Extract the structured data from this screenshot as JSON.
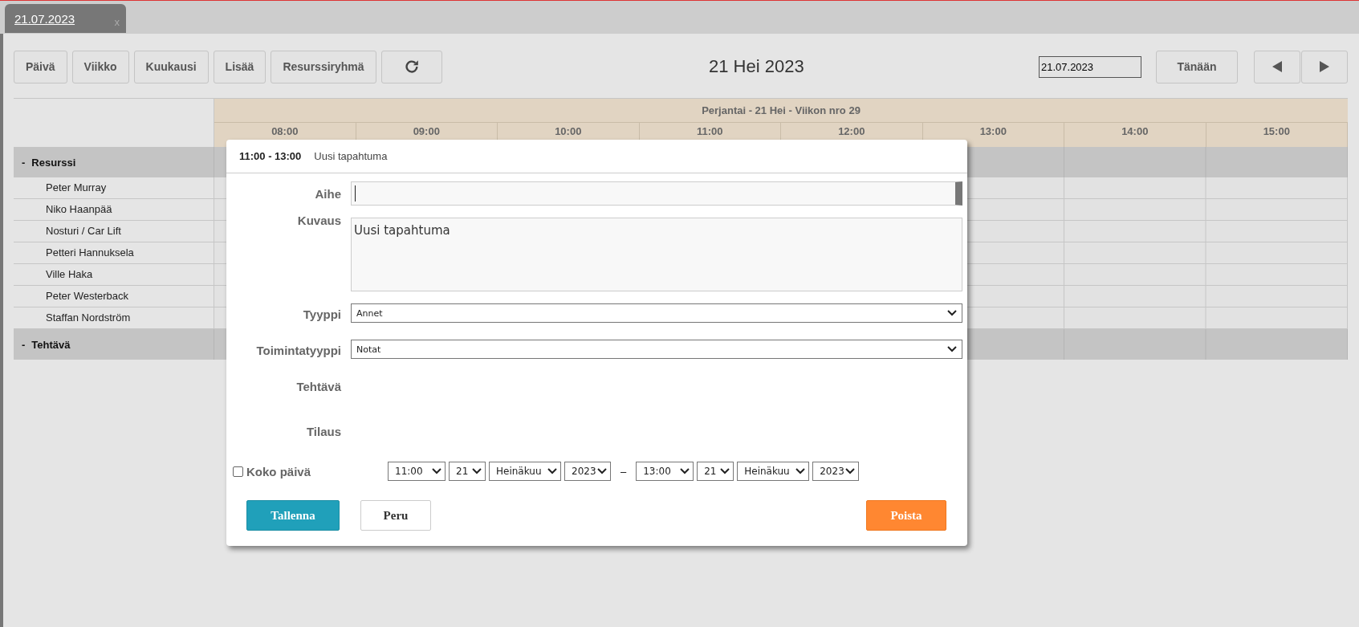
{
  "tab": {
    "label": "21.07.2023",
    "close": "x"
  },
  "toolbar": {
    "buttons": [
      "Päivä",
      "Viikko",
      "Kuukausi",
      "Lisää",
      "Resurssiryhmä"
    ],
    "title": "21 Hei 2023",
    "date_value": "21.07.2023",
    "today": "Tänään"
  },
  "calendar": {
    "day_label": "Perjantai - 21 Hei - Viikon nro 29",
    "hours": [
      "08:00",
      "09:00",
      "10:00",
      "11:00",
      "12:00",
      "13:00",
      "14:00",
      "15:00"
    ],
    "groups": [
      {
        "toggle": "-",
        "label": "Resurssi",
        "children": [
          "Peter Murray",
          "Niko Haanpää",
          "Nosturi / Car Lift",
          "Petteri Hannuksela",
          "Ville Haka",
          "Peter Westerback",
          "Staffan Nordström"
        ]
      },
      {
        "toggle": "-",
        "label": "Tehtävä"
      }
    ]
  },
  "dialog": {
    "time": "11:00 - 13:00",
    "title": "Uusi tapahtuma",
    "fields": [
      {
        "label": "Aihe",
        "kind": "text"
      },
      {
        "label": "Kuvaus",
        "kind": "textarea",
        "value": "Uusi tapahtuma"
      },
      {
        "label": "Tyyppi",
        "kind": "select",
        "value": "Annet"
      },
      {
        "label": "Toimintatyyppi",
        "kind": "select",
        "value": "Notat"
      },
      {
        "label": "Tehtävä",
        "kind": "empty"
      },
      {
        "label": "Tilaus",
        "kind": "empty"
      }
    ],
    "all_day": {
      "label": "Koko päivä",
      "checked": false
    },
    "start": [
      "11:00",
      "21",
      "Heinäkuu",
      "2023"
    ],
    "separator": "–",
    "end": [
      "13:00",
      "21",
      "Heinäkuu",
      "2023"
    ],
    "buttons": [
      {
        "label": "Tallenna",
        "kind": "primary"
      },
      {
        "label": "Peru",
        "kind": "plain"
      },
      {
        "label": "Poista",
        "kind": "danger"
      }
    ]
  }
}
